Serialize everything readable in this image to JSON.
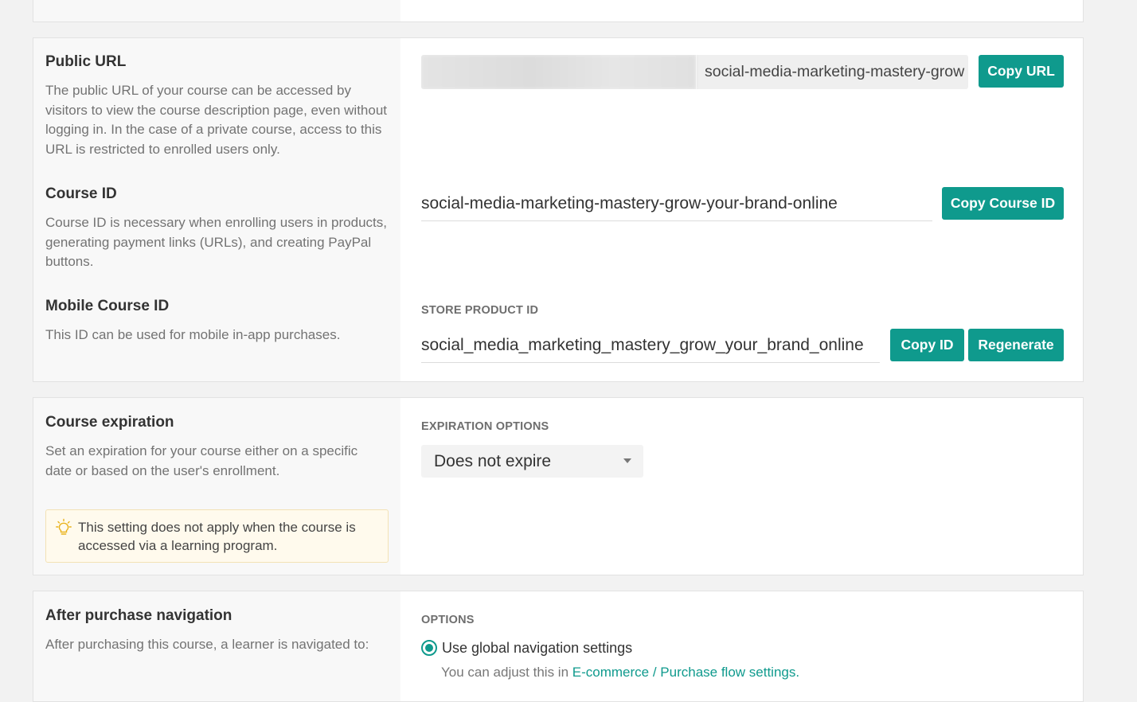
{
  "public_url": {
    "title": "Public URL",
    "description": "The public URL of your course can be accessed by visitors to view the course description page, even without logging in. In the case of a private course, access to this URL is restricted to enrolled users only.",
    "url_suffix": "social-media-marketing-mastery-grow",
    "copy_label": "Copy URL"
  },
  "course_id": {
    "title": "Course ID",
    "description": "Course ID is necessary when enrolling users in products, generating payment links (URLs), and creating PayPal buttons.",
    "value": "social-media-marketing-mastery-grow-your-brand-online",
    "copy_label": "Copy Course ID"
  },
  "mobile_course_id": {
    "title": "Mobile Course ID",
    "description": "This ID can be used for mobile in-app purchases.",
    "field_label": "STORE PRODUCT ID",
    "value": "social_media_marketing_mastery_grow_your_brand_online",
    "copy_label": "Copy ID",
    "regenerate_label": "Regenerate"
  },
  "expiration": {
    "title": "Course expiration",
    "description": "Set an expiration for your course either on a specific date or based on the user's enrollment.",
    "notice": "This setting does not apply when the course is accessed via a learning program.",
    "options_label": "EXPIRATION OPTIONS",
    "selected_option": "Does not expire"
  },
  "after_purchase": {
    "title": "After purchase navigation",
    "description": "After purchasing this course, a learner is navigated to:",
    "options_label": "OPTIONS",
    "option_label": "Use global navigation settings",
    "hint_prefix": "You can adjust this in ",
    "hint_link": "E-commerce / Purchase flow settings."
  },
  "colors": {
    "accent": "#0f9a8d",
    "notice_bg": "#fffaed",
    "notice_border": "#f3e2b5",
    "bulb": "#e9b21b"
  }
}
